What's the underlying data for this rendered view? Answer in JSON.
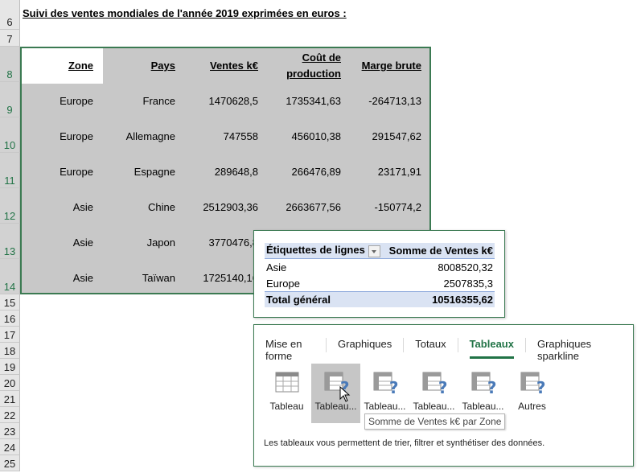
{
  "sheet": {
    "title": "Suivi des ventes mondiales de l'année 2019 exprimées en euros :",
    "rows": [
      "6",
      "7",
      "8",
      "9",
      "10",
      "11",
      "12",
      "13",
      "14",
      "15",
      "16",
      "17",
      "18",
      "19",
      "20",
      "21",
      "22",
      "23",
      "24",
      "25"
    ],
    "headers": [
      "Zone",
      "Pays",
      "Ventes k€",
      "Coût de production",
      "Marge brute"
    ],
    "header_cout_line1": "Coût de",
    "header_cout_line2": "production",
    "data": [
      [
        "Europe",
        "France",
        "1470628,5",
        "1735341,63",
        "-264713,13"
      ],
      [
        "Europe",
        "Allemagne",
        "747558",
        "456010,38",
        "291547,62"
      ],
      [
        "Europe",
        "Espagne",
        "289648,8",
        "266476,89",
        "23171,91"
      ],
      [
        "Asie",
        "Chine",
        "2512903,36",
        "2663677,56",
        "-150774,2"
      ],
      [
        "Asie",
        "Japon",
        "3770476,8",
        "",
        ""
      ],
      [
        "Asie",
        "Taïwan",
        "1725140,16",
        "",
        ""
      ]
    ],
    "selection_border_color": "#3b7a52"
  },
  "pivot_preview": {
    "col1_header": "Étiquettes de lignes",
    "col2_header": "Somme de Ventes k€",
    "rows": [
      {
        "label": "Asie",
        "value": "8008520,32"
      },
      {
        "label": "Europe",
        "value": "2507835,3"
      }
    ],
    "total_label": "Total général",
    "total_value": "10516355,62"
  },
  "quick_analysis": {
    "tabs": [
      {
        "label": "Mise en forme",
        "active": false
      },
      {
        "label": "Graphiques",
        "active": false
      },
      {
        "label": "Totaux",
        "active": false
      },
      {
        "label": "Tableaux",
        "active": true
      },
      {
        "label": "Graphiques sparkline",
        "active": false
      }
    ],
    "options": [
      {
        "label": "Tableau",
        "icon": "table-icon"
      },
      {
        "label": "Tableau...",
        "icon": "pivot-table-icon"
      },
      {
        "label": "Tableau...",
        "icon": "pivot-table-icon"
      },
      {
        "label": "Tableau...",
        "icon": "pivot-table-icon"
      },
      {
        "label": "Tableau...",
        "icon": "pivot-table-icon"
      },
      {
        "label": "Autres",
        "icon": "pivot-table-icon"
      }
    ],
    "tooltip": "Somme de Ventes k€ par Zone",
    "description": "Les tableaux vous permettent de trier, filtrer et synthétiser des données.",
    "accent_color": "#217346"
  }
}
